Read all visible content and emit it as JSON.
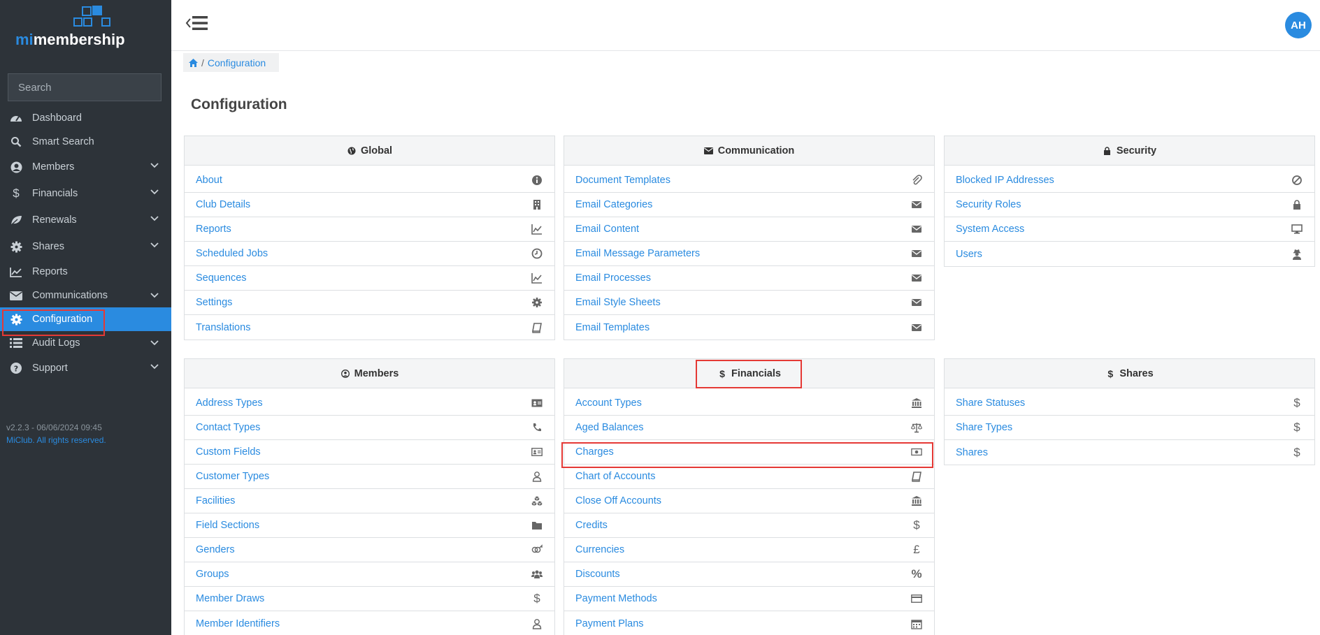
{
  "brand": {
    "prefix": "mi",
    "name": "membership"
  },
  "search": {
    "placeholder": "Search"
  },
  "nav": [
    {
      "label": "Dashboard",
      "icon": "dashboard-icon",
      "chevron": false
    },
    {
      "label": "Smart Search",
      "icon": "search-icon",
      "chevron": false
    },
    {
      "label": "Members",
      "icon": "user-circle-icon",
      "chevron": true
    },
    {
      "label": "Financials",
      "icon": "dollar-icon",
      "chevron": true
    },
    {
      "label": "Renewals",
      "icon": "leaf-icon",
      "chevron": true
    },
    {
      "label": "Shares",
      "icon": "cog-icon",
      "chevron": true
    },
    {
      "label": "Reports",
      "icon": "chart-line-icon",
      "chevron": false
    },
    {
      "label": "Communications",
      "icon": "envelope-icon",
      "chevron": true
    },
    {
      "label": "Configuration",
      "icon": "gear-icon",
      "chevron": false,
      "active": true
    },
    {
      "label": "Audit Logs",
      "icon": "list-icon",
      "chevron": true
    },
    {
      "label": "Support",
      "icon": "question-icon",
      "chevron": true
    }
  ],
  "footer": {
    "version": "v2.2.3 - 06/06/2024 09:45",
    "copyright": "MiClub. All rights reserved."
  },
  "user": {
    "initials": "AH"
  },
  "breadcrumb": {
    "current": "Configuration"
  },
  "page": {
    "title": "Configuration"
  },
  "panels": {
    "global": {
      "title": "Global",
      "items": [
        {
          "label": "About",
          "icon": "info-icon"
        },
        {
          "label": "Club Details",
          "icon": "building-icon"
        },
        {
          "label": "Reports",
          "icon": "chart-line-icon"
        },
        {
          "label": "Scheduled Jobs",
          "icon": "clock-icon"
        },
        {
          "label": "Sequences",
          "icon": "chart-line-icon"
        },
        {
          "label": "Settings",
          "icon": "gear-icon"
        },
        {
          "label": "Translations",
          "icon": "book-icon"
        }
      ]
    },
    "communication": {
      "title": "Communication",
      "items": [
        {
          "label": "Document Templates",
          "icon": "paperclip-icon"
        },
        {
          "label": "Email Categories",
          "icon": "envelope-icon"
        },
        {
          "label": "Email Content",
          "icon": "envelope-icon"
        },
        {
          "label": "Email Message Parameters",
          "icon": "envelope-icon"
        },
        {
          "label": "Email Processes",
          "icon": "envelope-icon"
        },
        {
          "label": "Email Style Sheets",
          "icon": "envelope-icon"
        },
        {
          "label": "Email Templates",
          "icon": "envelope-icon"
        }
      ]
    },
    "security": {
      "title": "Security",
      "items": [
        {
          "label": "Blocked IP Addresses",
          "icon": "ban-icon"
        },
        {
          "label": "Security Roles",
          "icon": "lock-icon"
        },
        {
          "label": "System Access",
          "icon": "desktop-icon"
        },
        {
          "label": "Users",
          "icon": "user-secret-icon"
        }
      ]
    },
    "members": {
      "title": "Members",
      "items": [
        {
          "label": "Address Types",
          "icon": "address-card-icon"
        },
        {
          "label": "Contact Types",
          "icon": "phone-icon"
        },
        {
          "label": "Custom Fields",
          "icon": "id-card-icon"
        },
        {
          "label": "Customer Types",
          "icon": "user-icon"
        },
        {
          "label": "Facilities",
          "icon": "cubes-icon"
        },
        {
          "label": "Field Sections",
          "icon": "folder-icon"
        },
        {
          "label": "Genders",
          "icon": "genderless-icon"
        },
        {
          "label": "Groups",
          "icon": "users-icon"
        },
        {
          "label": "Member Draws",
          "icon": "dollar-icon"
        },
        {
          "label": "Member Identifiers",
          "icon": "user-icon"
        }
      ]
    },
    "financials": {
      "title": "Financials",
      "items": [
        {
          "label": "Account Types",
          "icon": "bank-icon"
        },
        {
          "label": "Aged Balances",
          "icon": "balance-scale-icon"
        },
        {
          "label": "Charges",
          "icon": "money-bill-icon"
        },
        {
          "label": "Chart of Accounts",
          "icon": "book-icon"
        },
        {
          "label": "Close Off Accounts",
          "icon": "bank-icon"
        },
        {
          "label": "Credits",
          "icon": "dollar-icon"
        },
        {
          "label": "Currencies",
          "icon": "pound-icon"
        },
        {
          "label": "Discounts",
          "icon": "percent-icon"
        },
        {
          "label": "Payment Methods",
          "icon": "credit-card-icon"
        },
        {
          "label": "Payment Plans",
          "icon": "calendar-icon"
        }
      ]
    },
    "shares": {
      "title": "Shares",
      "items": [
        {
          "label": "Share Statuses",
          "icon": "dollar-icon"
        },
        {
          "label": "Share Types",
          "icon": "dollar-icon"
        },
        {
          "label": "Shares",
          "icon": "dollar-icon"
        }
      ]
    }
  },
  "colors": {
    "accent": "#2a8be0",
    "sidebar": "#2d3339",
    "highlight": "#e53935"
  }
}
